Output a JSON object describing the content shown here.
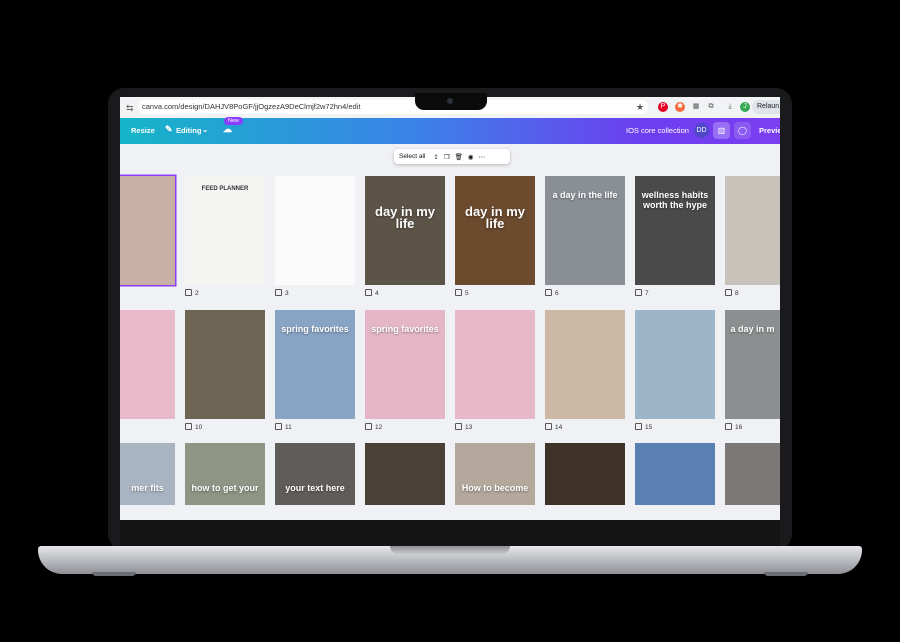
{
  "browser": {
    "url": "canva.com/design/DAHJV8PoGF/jjOgzezA9DeClmjf2w72hn4/edit",
    "relaunch_label": "Relaun"
  },
  "canva_header": {
    "resize_label": "Resize",
    "editing_label": "Editing",
    "new_badge": "New",
    "collection_title": "IOS core collection",
    "avatar_initials": "DD",
    "preview_label": "Previe"
  },
  "selection_toolbar": {
    "select_all_label": "Select all"
  },
  "page_thumbnails": {
    "rows": [
      [
        {
          "number": "",
          "overlay": "",
          "theme": "#c9b0a6"
        },
        {
          "number": "2",
          "overlay": "FEED PLANNER",
          "theme": "#f4f4f2"
        },
        {
          "number": "3",
          "overlay": "",
          "theme": "#fafafa"
        },
        {
          "number": "4",
          "overlay": "day in my life",
          "theme": "#5d5448"
        },
        {
          "number": "5",
          "overlay": "day in my life",
          "theme": "#6b4a2e"
        },
        {
          "number": "6",
          "overlay": "a day in the life",
          "theme": "#8a8f96"
        },
        {
          "number": "7",
          "overlay": "wellness habits worth the hype",
          "theme": "#4a4a4a"
        },
        {
          "number": "8",
          "overlay": "",
          "theme": "#c7c2ba"
        }
      ],
      [
        {
          "number": "",
          "overlay": "",
          "theme": "#e8b9c8"
        },
        {
          "number": "10",
          "overlay": "",
          "theme": "#6d6454"
        },
        {
          "number": "11",
          "overlay": "spring favorites",
          "theme": "#88a4c4"
        },
        {
          "number": "12",
          "overlay": "spring favorites",
          "theme": "#e5b7c6"
        },
        {
          "number": "13",
          "overlay": "",
          "theme": "#e6b8c8"
        },
        {
          "number": "14",
          "overlay": "",
          "theme": "#cdb9a3"
        },
        {
          "number": "15",
          "overlay": "",
          "theme": "#9cb5c9"
        },
        {
          "number": "16",
          "overlay": "a day in m",
          "theme": "#8c8f90"
        }
      ],
      [
        {
          "number": "",
          "overlay": "mer fits",
          "theme": "#a9b4c2"
        },
        {
          "number": "",
          "overlay": "how to get your",
          "theme": "#8f9584"
        },
        {
          "number": "",
          "overlay": "your text here",
          "theme": "#5f5c5a"
        },
        {
          "number": "",
          "overlay": "",
          "theme": "#4b4038"
        },
        {
          "number": "",
          "overlay": "How to become",
          "theme": "#b4a89d"
        },
        {
          "number": "",
          "overlay": "",
          "theme": "#3e3127"
        },
        {
          "number": "",
          "overlay": "",
          "theme": "#5a7fb3"
        },
        {
          "number": "",
          "overlay": "",
          "theme": "#7c7878"
        }
      ]
    ]
  },
  "colors": {
    "header_start": "#16b5c8",
    "header_end": "#7b3ff0",
    "selection_border": "#8b3dff"
  }
}
